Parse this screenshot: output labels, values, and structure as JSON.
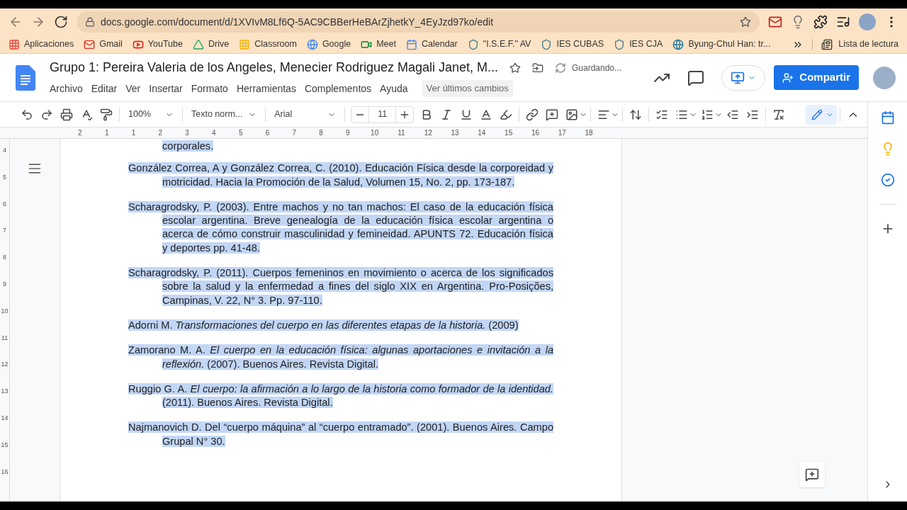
{
  "browser": {
    "url": "docs.google.com/document/d/1XVIvM8Lf6Q-5AC9CBBerHeBArZjhetkY_4EyJzd97ko/edit",
    "bookmarks": [
      {
        "kind": "apps",
        "label": "Aplicaciones"
      },
      {
        "kind": "mail",
        "label": "Gmail"
      },
      {
        "kind": "video",
        "label": "YouTube"
      },
      {
        "kind": "drive",
        "label": "Drive"
      },
      {
        "kind": "classroom",
        "label": "Classroom"
      },
      {
        "kind": "g",
        "label": "Google"
      },
      {
        "kind": "meet",
        "label": "Meet"
      },
      {
        "kind": "calendar",
        "label": "Calendar"
      },
      {
        "kind": "shield",
        "label": "\"I.S.E.F.\" AV"
      },
      {
        "kind": "shield",
        "label": "IES CUBAS"
      },
      {
        "kind": "shield",
        "label": "IES CJA"
      },
      {
        "kind": "wp",
        "label": "Byung-Chul Han: tr..."
      }
    ],
    "reading_list": "Lista de lectura"
  },
  "doc": {
    "title": "Grupo 1: Pereira Valeria de los Angeles, Menecier Rodriguez Magali Janet, M...",
    "save_status": "Guardando...",
    "menu": [
      "Archivo",
      "Editar",
      "Ver",
      "Insertar",
      "Formato",
      "Herramientas",
      "Complementos",
      "Ayuda"
    ],
    "last_changes": "Ver últimos cambios",
    "share": "Compartir"
  },
  "toolbar": {
    "zoom": "100%",
    "style": "Texto norm...",
    "font": "Arial",
    "size": "11"
  },
  "ruler": [
    "2",
    "1",
    "1",
    "2",
    "3",
    "4",
    "5",
    "6",
    "7",
    "8",
    "9",
    "10",
    "11",
    "12",
    "13",
    "14",
    "15",
    "16",
    "17",
    "18"
  ],
  "vruler": [
    "4",
    "5",
    "6",
    "7",
    "8",
    "9",
    "10",
    "11",
    "12",
    "13",
    "14",
    "15",
    "16"
  ],
  "top_fragment": "corporales.",
  "references": [
    "González Correa, A y González Correa, C. (2010). Educación Física desde la corporeidad y motricidad. Hacia la Promoción de la Salud, Volumen 15, No. 2, pp. 173-187.",
    "Scharagrodsky, P. (2003). Entre machos y no tan machos: El caso de la educación física escolar argentina. Breve genealogía de la educación física escolar argentina o acerca de cómo construir masculinidad y femineidad. APUNTS 72. Educación física y deportes pp. 41-48.",
    "Scharagrodsky, P. (2011). Cuerpos femeninos en movimiento o acerca de los significados sobre la salud y la enfermedad a fines del siglo XIX en Argentina. Pro-Posições, Campinas, V. 22, N° 3. Pp. 97-110.",
    "Adorni M. *Transformaciones del cuerpo en las diferentes etapas de la historia.* (2009)",
    "Zamorano M. A. *El cuerpo en la educación física: algunas aportaciones e invitación a la reflexión.* (2007). Buenos Aires.  Revista Digital.",
    "Ruggio G. A. *El cuerpo: la afirmación a lo largo de la historia como formador de la identidad.* (2011). Buenos Aires. Revista Digital.",
    "Najmanovich D. Del “cuerpo máquina” al “cuerpo entramado”. (2001). Buenos Aires. Campo Grupal N° 30."
  ]
}
